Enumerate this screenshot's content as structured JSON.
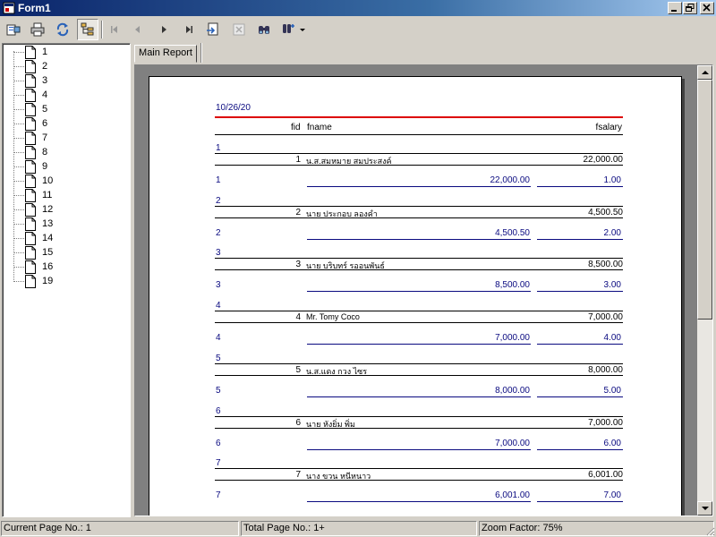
{
  "window": {
    "title": "Form1"
  },
  "tree": {
    "pages": [
      "1",
      "2",
      "3",
      "4",
      "5",
      "6",
      "7",
      "8",
      "9",
      "10",
      "11",
      "12",
      "13",
      "14",
      "15",
      "16",
      "19"
    ]
  },
  "tabs": {
    "main_label": "Main Report"
  },
  "report": {
    "date": "10/26/20",
    "headers": {
      "fid": "fid",
      "fname": "fname",
      "fsalary": "fsalary"
    },
    "groups": [
      {
        "id": "1",
        "fid": "1",
        "fname": "น.ส.สมหมาย สมประสงค์",
        "salary": "22,000.00",
        "sum": "22,000.00",
        "count": "1.00"
      },
      {
        "id": "2",
        "fid": "2",
        "fname": "นาย ประกอบ ลองคำ",
        "salary": "4,500.50",
        "sum": "4,500.50",
        "count": "2.00"
      },
      {
        "id": "3",
        "fid": "3",
        "fname": "นาย บริบทร์ รออนพันธ์",
        "salary": "8,500.00",
        "sum": "8,500.00",
        "count": "3.00"
      },
      {
        "id": "4",
        "fid": "4",
        "fname": "Mr. Tomy Coco",
        "salary": "7,000.00",
        "sum": "7,000.00",
        "count": "4.00"
      },
      {
        "id": "5",
        "fid": "5",
        "fname": "น.ส.แดง กวง ไซร",
        "salary": "8,000.00",
        "sum": "8,000.00",
        "count": "5.00"
      },
      {
        "id": "6",
        "fid": "6",
        "fname": "นาย หังยิ่ม พิ่ม",
        "salary": "7,000.00",
        "sum": "7,000.00",
        "count": "6.00"
      },
      {
        "id": "7",
        "fid": "7",
        "fname": "นาง ขวน หนีหนาว",
        "salary": "6,001.00",
        "sum": "6,001.00",
        "count": "7.00"
      }
    ]
  },
  "status": {
    "current_page": "Current Page No.: 1",
    "total_pages": "Total Page No.: 1+",
    "zoom": "Zoom Factor: 75%"
  },
  "icons": {
    "toolbar": [
      "export-icon",
      "print-icon",
      "refresh-icon",
      "toggle-tree-icon",
      "first-page-icon",
      "prev-page-icon",
      "next-page-icon",
      "last-page-icon",
      "goto-page-icon",
      "close-view-icon",
      "find-icon",
      "zoom-icon"
    ]
  }
}
